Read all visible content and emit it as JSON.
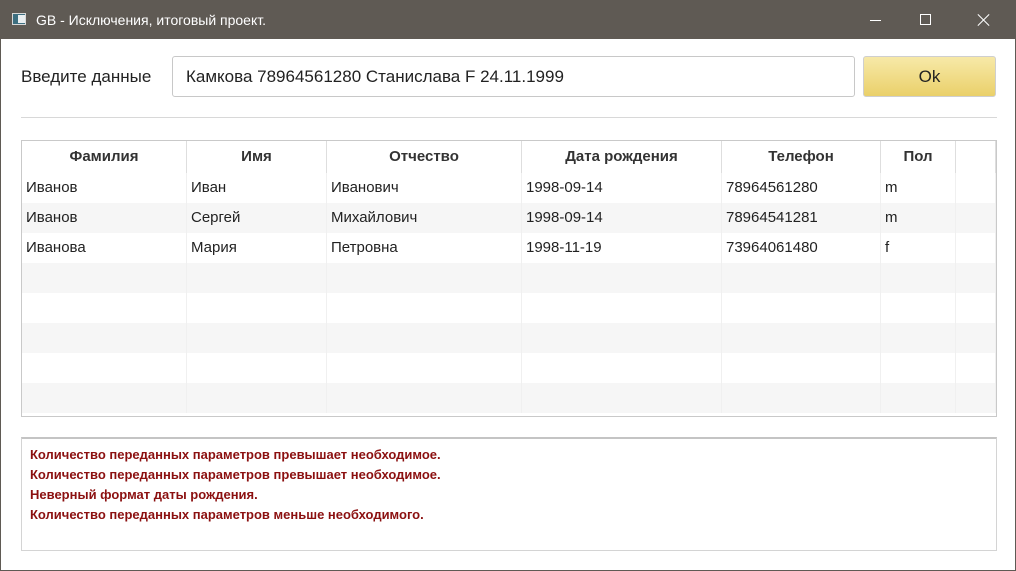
{
  "window": {
    "title": "GB - Исключения, итоговый проект."
  },
  "form": {
    "label": "Введите данные",
    "input_value": "Камкова 78964561280 Станислава F 24.11.1999",
    "ok_label": "Ok"
  },
  "table": {
    "columns": [
      "Фамилия",
      "Имя",
      "Отчество",
      "Дата рождения",
      "Телефон",
      "Пол"
    ],
    "rows": [
      [
        "Иванов",
        "Иван",
        "Иванович",
        "1998-09-14",
        "78964561280",
        "m"
      ],
      [
        "Иванов",
        "Сергей",
        "Михайлович",
        "1998-09-14",
        "78964541281",
        "m"
      ],
      [
        "Иванова",
        "Мария",
        "Петровна",
        "1998-11-19",
        "73964061480",
        "f"
      ]
    ]
  },
  "log": {
    "messages": [
      "Количество переданных параметров превышает необходимое.",
      "Количество переданных параметров превышает необходимое.",
      "Неверный формат даты рождения.",
      "Количество переданных параметров меньше необходимого."
    ]
  },
  "colors": {
    "titlebar": "#5f5a54",
    "ok_button": "#ead06a",
    "error_text": "#8b1010"
  }
}
